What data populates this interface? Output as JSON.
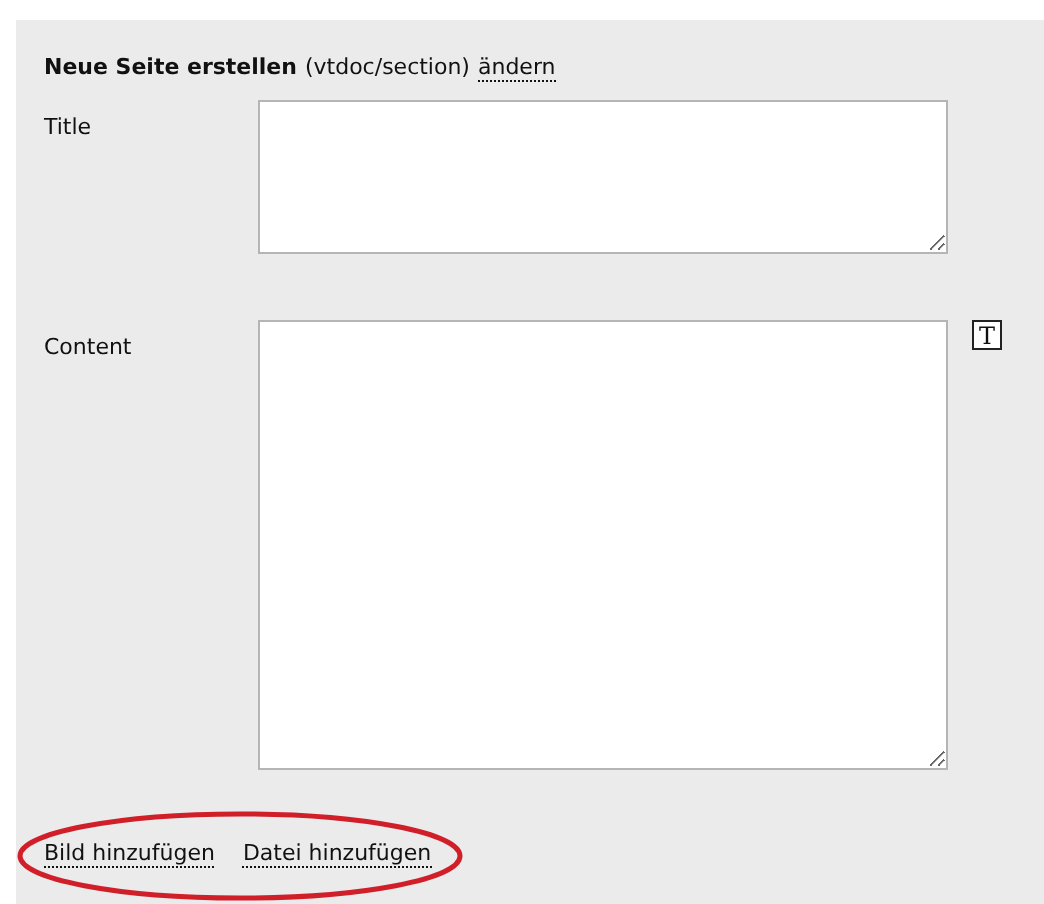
{
  "heading": {
    "title": "Neue Seite erstellen",
    "type": "(vtdoc/section)",
    "change_link": "ändern"
  },
  "fields": [
    {
      "label": "Title",
      "kind": "short"
    },
    {
      "label": "Content",
      "kind": "long",
      "format_button": "T"
    }
  ],
  "links": [
    "Bild hinzufügen",
    "Datei hinzufügen"
  ]
}
